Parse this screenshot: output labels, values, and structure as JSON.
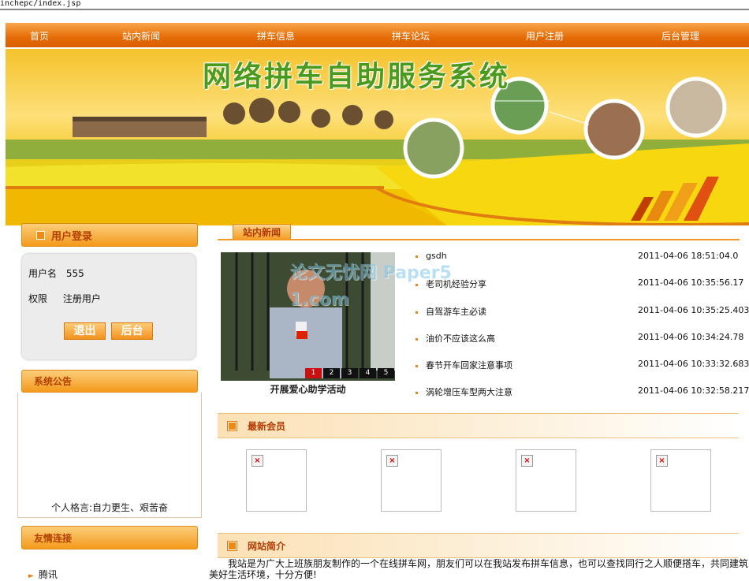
{
  "url": "inchepc/index.jsp",
  "nav": [
    "首页",
    "站内新闻",
    "拼车信息",
    "拼车论坛",
    "用户注册",
    "后台管理"
  ],
  "banner_title": "网络拼车自助服务系统",
  "login": {
    "header": "用户登录",
    "username_label": "用户名",
    "username_value": "555",
    "role_label": "权限",
    "role_value": "注册用户",
    "logout_button": "退出",
    "admin_button": "后台"
  },
  "notice": {
    "header": "系统公告",
    "text": "个人格言:自力更生、艰苦奋"
  },
  "links": {
    "header": "友情连接",
    "items": [
      "腾讯"
    ]
  },
  "news": {
    "tab": "站内新闻",
    "photo_caption": "开展爱心助学活动",
    "photo_pages": [
      "1",
      "2",
      "3",
      "4",
      "5"
    ],
    "items": [
      {
        "title": "gsdh",
        "date": "2011-04-06 18:51:04.0"
      },
      {
        "title": "老司机经验分享",
        "date": "2011-04-06 10:35:56.17"
      },
      {
        "title": "自驾游车主必读",
        "date": "2011-04-06 10:35:25.403"
      },
      {
        "title": "油价不应该这么高",
        "date": "2011-04-06 10:34:24.78"
      },
      {
        "title": "春节开车回家注意事项",
        "date": "2011-04-06 10:33:32.683"
      },
      {
        "title": "涡轮增压车型两大注意",
        "date": "2011-04-06 10:32:58.217"
      }
    ]
  },
  "members": {
    "header": "最新会员",
    "count": 4
  },
  "about": {
    "header": "网站简介",
    "text_line1": "我站是为广大上班族朋友制作的一个在线拼车网，朋友们可以在我站发布拼车信息，也可以查找同行之人顺便搭车，共同建筑",
    "text_line2": "美好生活环境，十分方便!"
  },
  "watermark": "论文无忧网 Paper51.com"
}
